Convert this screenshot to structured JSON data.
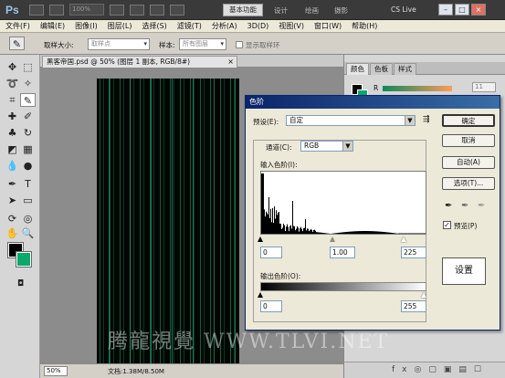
{
  "app": {
    "logo": "Ps",
    "zoom": "100%",
    "workspace": "基本功能",
    "ws_items": [
      "设计",
      "绘画",
      "摄影"
    ],
    "cs_live": "CS Live"
  },
  "window_controls": [
    "–",
    "□",
    "×"
  ],
  "menu": [
    "文件(F)",
    "编辑(E)",
    "图像(I)",
    "图层(L)",
    "选择(S)",
    "滤镜(T)",
    "分析(A)",
    "3D(D)",
    "视图(V)",
    "窗口(W)",
    "帮助(H)"
  ],
  "options": {
    "sample_size_label": "取样大小:",
    "sample_size_value": "取样点",
    "sample_label": "样本:",
    "sample_value": "所有图层",
    "ring_label": "显示取样环"
  },
  "document": {
    "tab": "黑客帝国.psd @ 50% (图层 1 副本, RGB/8#)",
    "close": "×",
    "zoom": "50%",
    "doc_info": "文档:1.38M/8.50M"
  },
  "panels": {
    "tabs": [
      "颜色",
      "色板",
      "样式"
    ],
    "channel_r": "R",
    "r_value": "11",
    "bottom_icons": "fx◎▢▣▤☐"
  },
  "watermark": "腾龍視覺 WWW.TLVI.NET",
  "levels": {
    "title": "色阶",
    "preset_label": "预设(E):",
    "preset_value": "自定",
    "channel_label": "通道(C):",
    "channel_value": "RGB",
    "input_label": "输入色阶(I):",
    "input_values": [
      "0",
      "1.00",
      "225"
    ],
    "output_label": "输出色阶(O):",
    "output_values": [
      "0",
      "255"
    ],
    "buttons": [
      "确定",
      "取消",
      "自动(A)",
      "选项(T)..."
    ],
    "preview_label": "预览(P)",
    "preview_checked": true
  },
  "annotation": "设置",
  "colors": {
    "foreground": "#000000",
    "background": "#0ba86b"
  }
}
